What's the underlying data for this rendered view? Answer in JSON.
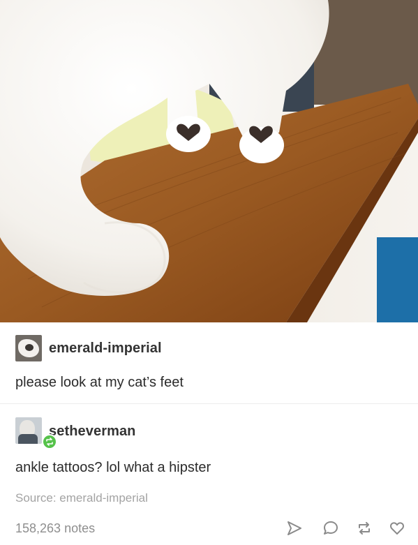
{
  "post": {
    "photo": {
      "subject": "white cat standing on a wooden shelf with heart-shaped marks on its paws"
    },
    "entries": [
      {
        "username": "emerald-imperial",
        "text": "please look at my cat’s feet",
        "avatar": "avatar-photo"
      },
      {
        "username": "setheverman",
        "text": "ankle tattoos? lol what a hipster",
        "avatar": "avatar-photo",
        "badge": "reblog-icon"
      }
    ],
    "source_text": "Source: emerald-imperial",
    "notes": "158,263 notes",
    "actions": [
      "share-icon",
      "reply-icon",
      "reblog-icon",
      "like-icon"
    ],
    "colors": {
      "action_icon": "#8a8a8a",
      "reblog_badge": "#55c24a",
      "wood": "#9a5a22"
    }
  }
}
